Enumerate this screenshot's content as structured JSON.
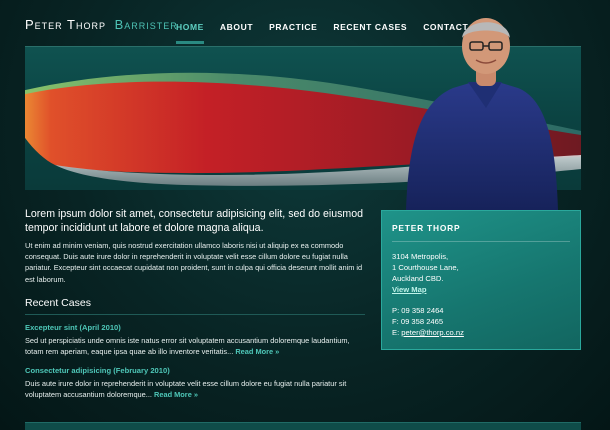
{
  "header": {
    "logo_name": "Peter Thorp",
    "logo_title": "Barrister",
    "nav": [
      {
        "label": "HOME",
        "active": true
      },
      {
        "label": "ABOUT"
      },
      {
        "label": "PRACTICE"
      },
      {
        "label": "RECENT CASES"
      },
      {
        "label": "CONTACT"
      }
    ]
  },
  "intro": {
    "lead": "Lorem ipsum dolor sit amet, consectetur adipisicing elit, sed do eiusmod tempor incididunt ut labore et dolore magna aliqua.",
    "body": "Ut enim ad minim veniam, quis nostrud exercitation ullamco laboris nisi ut aliquip ex ea commodo consequat. Duis aute irure dolor in reprehenderit in voluptate velit esse cillum dolore eu fugiat nulla pariatur. Excepteur sint occaecat cupidatat non proident, sunt in culpa qui officia deserunt mollit anim id est laborum."
  },
  "recent": {
    "heading": "Recent Cases",
    "cases": [
      {
        "title": "Excepteur sint (April 2010)",
        "text": "Sed ut perspiciatis unde omnis iste natus error sit voluptatem accusantium doloremque laudantium, totam rem aperiam, eaque ipsa quae ab illo inventore veritatis...",
        "more": "Read More »"
      },
      {
        "title": "Consectetur adipisicing (February 2010)",
        "text": "Duis aute irure dolor in reprehenderit in voluptate velit esse cillum dolore eu fugiat nulla pariatur sit voluptatem accusantium doloremque...",
        "more": "Read More »"
      }
    ]
  },
  "contact": {
    "name": "PETER THORP",
    "address_lines": [
      "3104 Metropolis,",
      "1 Courthouse Lane,",
      "Auckland CBD."
    ],
    "map_link": "View Map",
    "phone": "P: 09 358 2464",
    "fax": "F: 09 358 2465",
    "email_prefix": "E: ",
    "email": "peter@thorp.co.nz"
  },
  "colors": {
    "accent": "#4ec7b8",
    "background": "#082424",
    "contact_box": "#1a8079"
  }
}
